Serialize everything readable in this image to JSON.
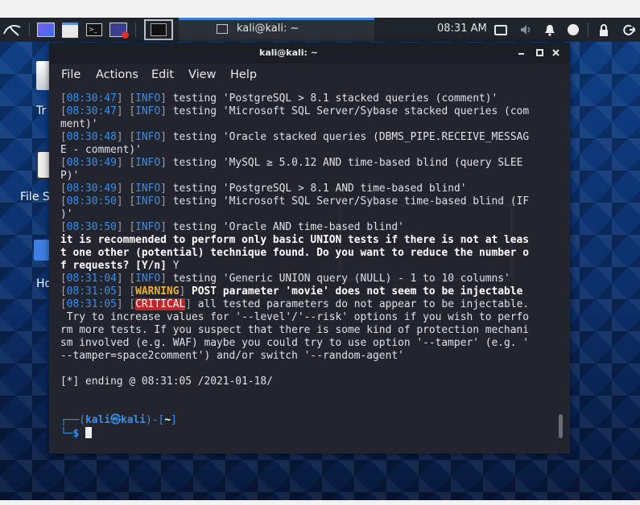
{
  "taskbar": {
    "active_window_label": "kali@kali: ~",
    "clock": "08:31 AM",
    "icons": [
      "kali-dragon-icon",
      "desktop-show-icon",
      "file-manager-icon",
      "terminal-icon",
      "screen-tool-icon",
      "terminal-active-icon",
      "terminal-small-icon",
      "display-icon",
      "volume-icon",
      "notification-bell-icon",
      "update-icon",
      "lock-icon",
      "logout-icon"
    ]
  },
  "desktop": {
    "icons": [
      {
        "name": "trash-icon",
        "label": "Tr"
      },
      {
        "name": "filesystem-icon",
        "label": "File S"
      },
      {
        "name": "home-icon",
        "label": "Ho"
      }
    ]
  },
  "window": {
    "title": "kali@kali: ~",
    "controls": [
      "minimize-icon",
      "maximize-icon",
      "close-icon"
    ],
    "menu": [
      "File",
      "Actions",
      "Edit",
      "View",
      "Help"
    ]
  },
  "terminal": {
    "lines": [
      [
        {
          "c": "br",
          "t": "["
        },
        {
          "c": "ts",
          "t": "08:30:47"
        },
        {
          "c": "br",
          "t": "] ["
        },
        {
          "c": "info",
          "t": "INFO"
        },
        {
          "c": "br",
          "t": "]"
        },
        {
          "c": "",
          "t": " testing 'PostgreSQL > 8.1 stacked queries (comment)'"
        }
      ],
      [
        {
          "c": "br",
          "t": "["
        },
        {
          "c": "ts",
          "t": "08:30:47"
        },
        {
          "c": "br",
          "t": "] ["
        },
        {
          "c": "info",
          "t": "INFO"
        },
        {
          "c": "br",
          "t": "]"
        },
        {
          "c": "",
          "t": " testing 'Microsoft SQL Server/Sybase stacked queries (com"
        }
      ],
      [
        {
          "c": "",
          "t": "ment)'"
        }
      ],
      [
        {
          "c": "br",
          "t": "["
        },
        {
          "c": "ts",
          "t": "08:30:48"
        },
        {
          "c": "br",
          "t": "] ["
        },
        {
          "c": "info",
          "t": "INFO"
        },
        {
          "c": "br",
          "t": "]"
        },
        {
          "c": "",
          "t": " testing 'Oracle stacked queries (DBMS_PIPE.RECEIVE_MESSAG"
        }
      ],
      [
        {
          "c": "",
          "t": "E - comment)'"
        }
      ],
      [
        {
          "c": "br",
          "t": "["
        },
        {
          "c": "ts",
          "t": "08:30:49"
        },
        {
          "c": "br",
          "t": "] ["
        },
        {
          "c": "info",
          "t": "INFO"
        },
        {
          "c": "br",
          "t": "]"
        },
        {
          "c": "",
          "t": " testing 'MySQL ≥ 5.0.12 AND time-based blind (query SLEE"
        }
      ],
      [
        {
          "c": "",
          "t": "P)'"
        }
      ],
      [
        {
          "c": "br",
          "t": "["
        },
        {
          "c": "ts",
          "t": "08:30:49"
        },
        {
          "c": "br",
          "t": "] ["
        },
        {
          "c": "info",
          "t": "INFO"
        },
        {
          "c": "br",
          "t": "]"
        },
        {
          "c": "",
          "t": " testing 'PostgreSQL > 8.1 AND time-based blind'"
        }
      ],
      [
        {
          "c": "br",
          "t": "["
        },
        {
          "c": "ts",
          "t": "08:30:50"
        },
        {
          "c": "br",
          "t": "] ["
        },
        {
          "c": "info",
          "t": "INFO"
        },
        {
          "c": "br",
          "t": "]"
        },
        {
          "c": "",
          "t": " testing 'Microsoft SQL Server/Sybase time-based blind (IF"
        }
      ],
      [
        {
          "c": "",
          "t": ")'"
        }
      ],
      [
        {
          "c": "br",
          "t": "["
        },
        {
          "c": "ts",
          "t": "08:30:50"
        },
        {
          "c": "br",
          "t": "] ["
        },
        {
          "c": "info",
          "t": "INFO"
        },
        {
          "c": "br",
          "t": "]"
        },
        {
          "c": "",
          "t": " testing 'Oracle AND time-based blind'"
        }
      ],
      [
        {
          "c": "bold",
          "t": "it is recommended to perform only basic UNION tests if there is not at leas"
        }
      ],
      [
        {
          "c": "bold",
          "t": "t one other (potential) technique found. Do you want to reduce the number o"
        }
      ],
      [
        {
          "c": "bold",
          "t": "f requests? [Y/n]"
        },
        {
          "c": "",
          "t": " Y"
        }
      ],
      [
        {
          "c": "br",
          "t": "["
        },
        {
          "c": "ts",
          "t": "08:31:04"
        },
        {
          "c": "br",
          "t": "] ["
        },
        {
          "c": "info",
          "t": "INFO"
        },
        {
          "c": "br",
          "t": "]"
        },
        {
          "c": "",
          "t": " testing 'Generic UNION query (NULL) - 1 to 10 columns'"
        }
      ],
      [
        {
          "c": "br",
          "t": "["
        },
        {
          "c": "ts",
          "t": "08:31:05"
        },
        {
          "c": "br",
          "t": "] ["
        },
        {
          "c": "warn",
          "t": "WARNING"
        },
        {
          "c": "br",
          "t": "]"
        },
        {
          "c": "bold",
          "t": " POST parameter 'movie' does not seem to be injectable"
        }
      ],
      [
        {
          "c": "br",
          "t": "["
        },
        {
          "c": "ts",
          "t": "08:31:05"
        },
        {
          "c": "br",
          "t": "] ["
        },
        {
          "c": "crit",
          "t": "CRITICAL"
        },
        {
          "c": "br",
          "t": "]"
        },
        {
          "c": "",
          "t": " all tested parameters do not appear to be injectable."
        }
      ],
      [
        {
          "c": "",
          "t": " Try to increase values for '--level'/'--risk' options if you wish to perfo"
        }
      ],
      [
        {
          "c": "",
          "t": "rm more tests. If you suspect that there is some kind of protection mechani"
        }
      ],
      [
        {
          "c": "",
          "t": "sm involved (e.g. WAF) maybe you could try to use option '--tamper' (e.g. '"
        }
      ],
      [
        {
          "c": "",
          "t": "--tamper=space2comment') and/or switch '--random-agent'"
        }
      ],
      [
        {
          "c": "",
          "t": ""
        }
      ],
      [
        {
          "c": "",
          "t": "[*] ending @ 08:31:05 /2021-01-18/"
        }
      ],
      [
        {
          "c": "",
          "t": ""
        }
      ],
      [
        {
          "c": "",
          "t": ""
        }
      ],
      [
        {
          "c": "prompt-c",
          "t": "┌──("
        },
        {
          "c": "prompt-u",
          "t": "kali㉿kali"
        },
        {
          "c": "prompt-c",
          "t": ")-["
        },
        {
          "c": "prompt-w",
          "t": "~"
        },
        {
          "c": "prompt-c",
          "t": "]"
        }
      ],
      [
        {
          "c": "prompt-c",
          "t": "└─"
        },
        {
          "c": "prompt-u",
          "t": "$"
        },
        {
          "c": "",
          "t": " "
        }
      ]
    ]
  }
}
